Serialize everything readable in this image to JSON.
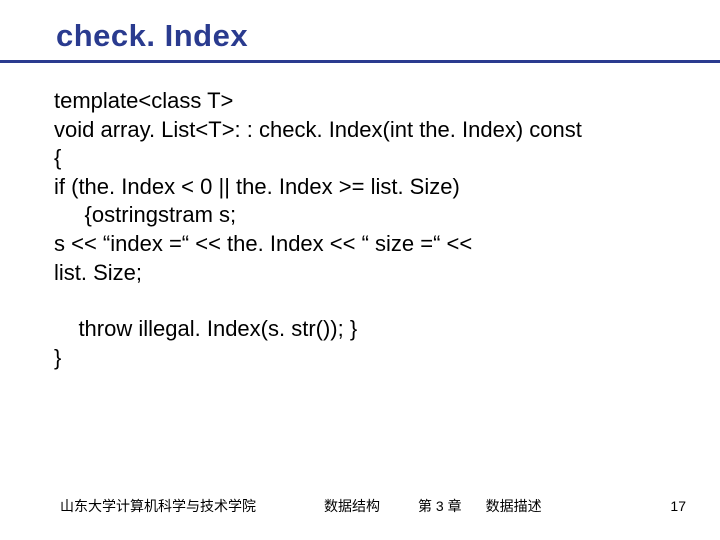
{
  "title": "check. Index",
  "code": {
    "l1": "template<class T>",
    "l2": "void array. List<T>: : check. Index(int the. Index) const",
    "l3": "{",
    "l4": " if (the. Index < 0 || the. Index >= list. Size)",
    "l5": "     {ostringstram s;",
    "l6": "s << “index =“ << the. Index << “ size =“ <<",
    "l7": "list. Size;",
    "l8": "    throw illegal. Index(s. str()); }",
    "l9": "}"
  },
  "footer": {
    "institution": "山东大学计算机科学与技术学院",
    "course": "数据结构",
    "chapter": "第 3 章",
    "topic": "数据描述",
    "page": "17"
  }
}
